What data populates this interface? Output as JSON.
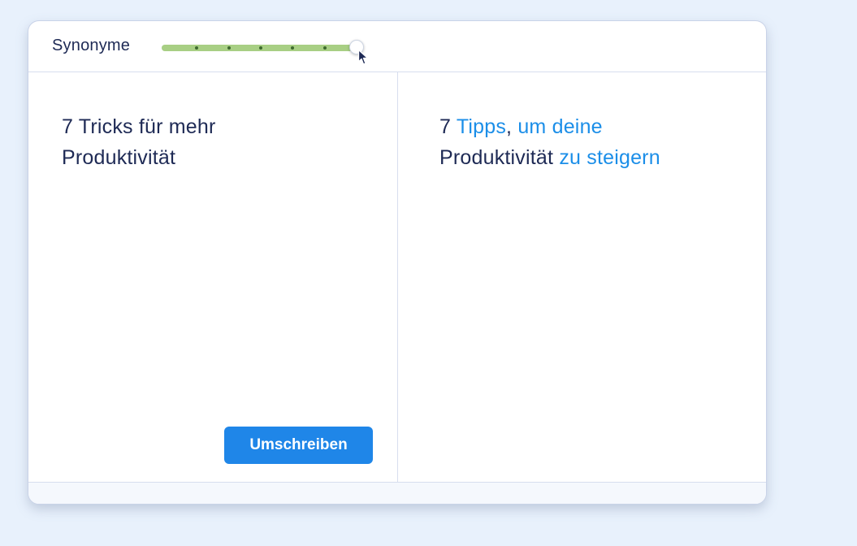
{
  "toolbar": {
    "label": "Synonyme",
    "slider": {
      "value_fraction": 1.0,
      "steps": 6,
      "filled_color": "#a8cf84",
      "track_color": "#e2e8f2"
    }
  },
  "input_pane": {
    "line1": "7 Tricks für mehr",
    "line2": "Produktivität"
  },
  "output_pane": {
    "t1": "7 ",
    "t2": "Tipps",
    "t3": ", ",
    "t4": "um deine",
    "t5": "Produktivität ",
    "t6": "zu steigern"
  },
  "actions": {
    "rewrite_label": "Umschreiben"
  },
  "colors": {
    "accent": "#1f86e8",
    "highlight_text": "#1b8ee8",
    "text": "#1e2a55"
  },
  "icons": {
    "cursor": "mouse-pointer-icon"
  }
}
